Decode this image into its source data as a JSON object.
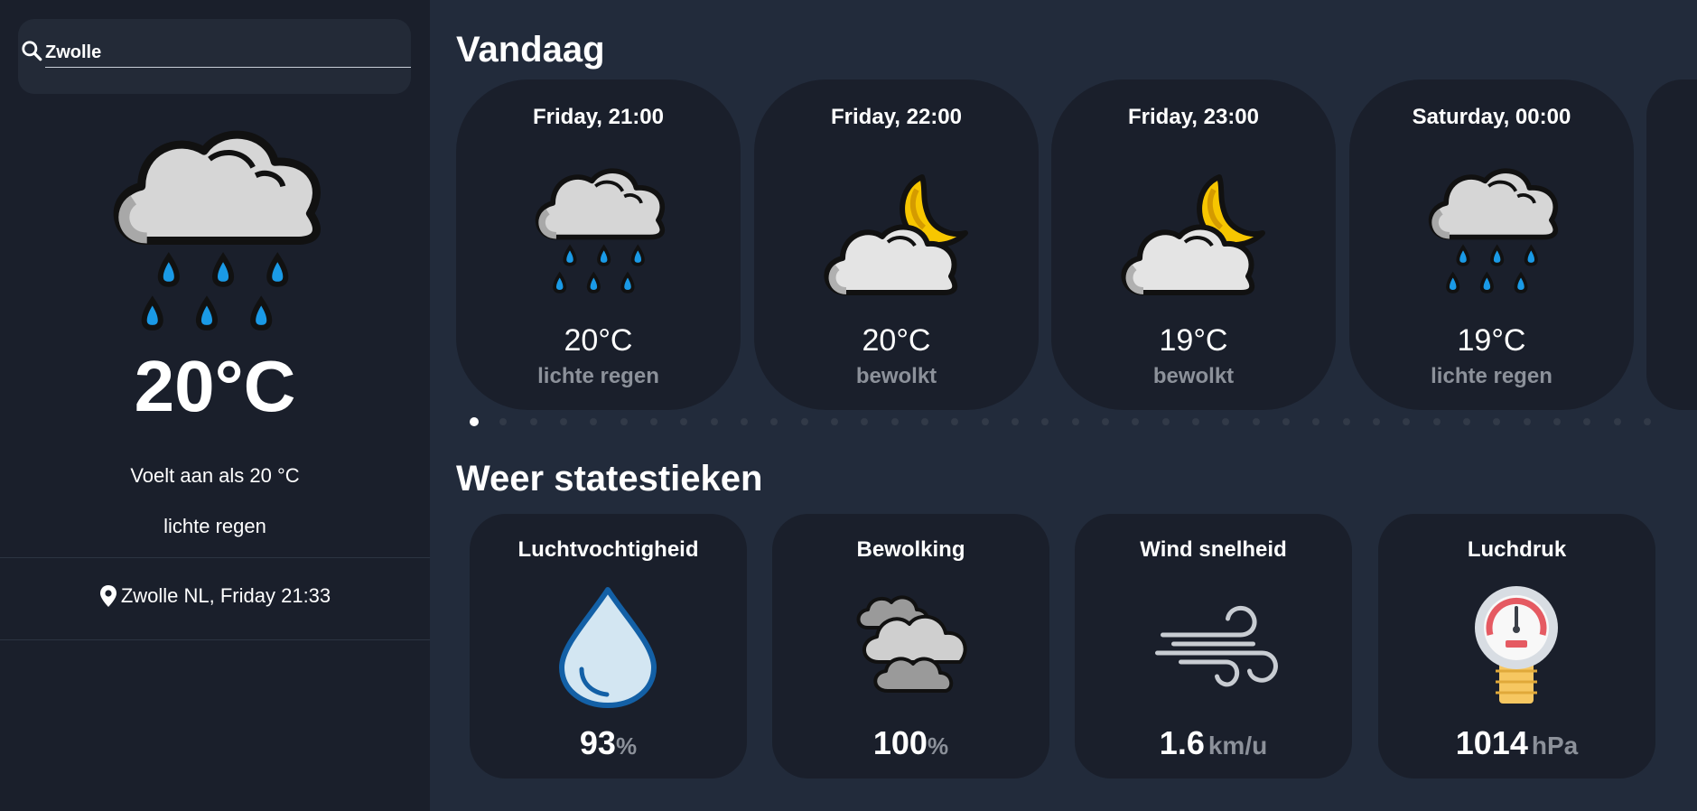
{
  "search": {
    "value": "Zwolle"
  },
  "current": {
    "icon": "rain-cloud-icon",
    "temperature": "20°C",
    "feels_like": "Voelt aan als 20 °C",
    "description": "lichte regen",
    "location": "Zwolle NL, Friday 21:33"
  },
  "today": {
    "title": "Vandaag",
    "forecast": [
      {
        "time": "Friday, 21:00",
        "temp": "20°C",
        "desc": "lichte regen",
        "icon": "rain-cloud-icon"
      },
      {
        "time": "Friday, 22:00",
        "temp": "20°C",
        "desc": "bewolkt",
        "icon": "cloud-moon-icon"
      },
      {
        "time": "Friday, 23:00",
        "temp": "19°C",
        "desc": "bewolkt",
        "icon": "cloud-moon-icon"
      },
      {
        "time": "Saturday, 00:00",
        "temp": "19°C",
        "desc": "lichte regen",
        "icon": "rain-cloud-icon"
      }
    ],
    "pagination": {
      "total_dots": 40,
      "active_index": 0
    }
  },
  "stats": {
    "title": "Weer statestieken",
    "items": [
      {
        "label": "Luchtvochtigheid",
        "value": "93",
        "unit": "%",
        "icon": "water-drop-icon"
      },
      {
        "label": "Bewolking",
        "value": "100",
        "unit": "%",
        "icon": "clouds-icon"
      },
      {
        "label": "Wind snelheid",
        "value": "1.6",
        "unit": "km/u",
        "icon": "wind-icon"
      },
      {
        "label": "Luchdruk",
        "value": "1014",
        "unit": "hPa",
        "icon": "pressure-gauge-icon"
      }
    ]
  },
  "colors": {
    "background": "#222b3b",
    "panel": "#1a1f2b",
    "muted_text": "#8c919a",
    "moon": "#f7c600",
    "rain": "#1a9ae6"
  }
}
